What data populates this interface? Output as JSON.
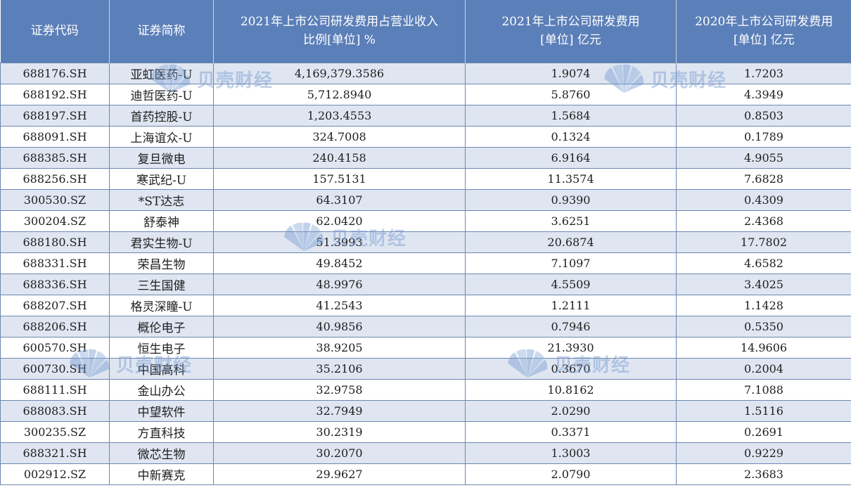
{
  "table": {
    "headers": [
      {
        "line1": "证券代码",
        "line2": ""
      },
      {
        "line1": "证券简称",
        "line2": ""
      },
      {
        "line1": "2021年上市公司研发费用占营业收入",
        "line2": "比例[单位] %"
      },
      {
        "line1": "2021年上市公司研发费用",
        "line2": "[单位] 亿元"
      },
      {
        "line1": "2020年上市公司研发费用",
        "line2": "[单位] 亿元"
      }
    ],
    "rows": [
      [
        "688176.SH",
        "亚虹医药-U",
        "4,169,379.3586",
        "1.9074",
        "1.7203"
      ],
      [
        "688192.SH",
        "迪哲医药-U",
        "5,712.8940",
        "5.8760",
        "4.3949"
      ],
      [
        "688197.SH",
        "首药控股-U",
        "1,203.4553",
        "1.5684",
        "0.8503"
      ],
      [
        "688091.SH",
        "上海谊众-U",
        "324.7008",
        "0.1324",
        "0.1789"
      ],
      [
        "688385.SH",
        "复旦微电",
        "240.4158",
        "6.9164",
        "4.9055"
      ],
      [
        "688256.SH",
        "寒武纪-U",
        "157.5131",
        "11.3574",
        "7.6828"
      ],
      [
        "300530.SZ",
        "*ST达志",
        "64.3107",
        "0.9390",
        "0.4309"
      ],
      [
        "300204.SZ",
        "舒泰神",
        "62.0420",
        "3.6251",
        "2.4368"
      ],
      [
        "688180.SH",
        "君实生物-U",
        "51.3993",
        "20.6874",
        "17.7802"
      ],
      [
        "688331.SH",
        "荣昌生物",
        "49.8452",
        "7.1097",
        "4.6582"
      ],
      [
        "688336.SH",
        "三生国健",
        "48.9976",
        "4.5509",
        "3.4025"
      ],
      [
        "688207.SH",
        "格灵深瞳-U",
        "41.2543",
        "1.2111",
        "1.1428"
      ],
      [
        "688206.SH",
        "概伦电子",
        "40.9856",
        "0.7946",
        "0.5350"
      ],
      [
        "600570.SH",
        "恒生电子",
        "38.9205",
        "21.3930",
        "14.9606"
      ],
      [
        "600730.SH",
        "中国高科",
        "35.2106",
        "0.3670",
        "0.2004"
      ],
      [
        "688111.SH",
        "金山办公",
        "32.9758",
        "10.8162",
        "7.1088"
      ],
      [
        "688083.SH",
        "中望软件",
        "32.7949",
        "2.0290",
        "1.5116"
      ],
      [
        "300235.SZ",
        "方直科技",
        "30.2319",
        "0.3371",
        "0.2691"
      ],
      [
        "688321.SH",
        "微芯生物",
        "30.2070",
        "1.3003",
        "0.9229"
      ],
      [
        "002912.SZ",
        "中新赛克",
        "29.9627",
        "2.0790",
        "2.3683"
      ]
    ]
  },
  "watermark": {
    "text": "贝壳财经",
    "color": "#6f95cf",
    "icon": "shell-logo-icon"
  },
  "colors": {
    "header_bg": "#5b7fb8",
    "header_text": "#ffffff",
    "row_band": "#dfe6f1",
    "row_plain": "#ffffff",
    "grid": "#6e86b0"
  }
}
